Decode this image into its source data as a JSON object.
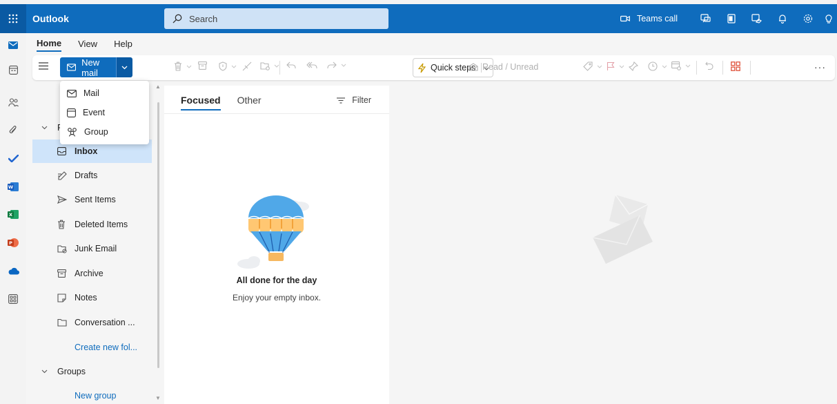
{
  "app": {
    "name": "Outlook"
  },
  "search": {
    "placeholder": "Search"
  },
  "topbar": {
    "teams_call": "Teams call"
  },
  "ribbon_tabs": [
    "Home",
    "View",
    "Help"
  ],
  "ribbon": {
    "new_mail": "New mail",
    "quick_steps": "Quick steps",
    "read_unread": "Read / Unread",
    "more": "···"
  },
  "new_menu": {
    "items": [
      "Mail",
      "Event",
      "Group"
    ]
  },
  "folders": {
    "section_letter": "F",
    "items": [
      "Inbox",
      "Drafts",
      "Sent Items",
      "Deleted Items",
      "Junk Email",
      "Archive",
      "Notes",
      "Conversation ..."
    ],
    "create_new": "Create new fol...",
    "groups_label": "Groups",
    "new_group": "New group"
  },
  "list": {
    "tabs": [
      "Focused",
      "Other"
    ],
    "filter": "Filter",
    "empty_title": "All done for the day",
    "empty_subtitle": "Enjoy your empty inbox."
  },
  "colors": {
    "brand": "#0f6cbd",
    "selected": "#cfe4fa"
  }
}
